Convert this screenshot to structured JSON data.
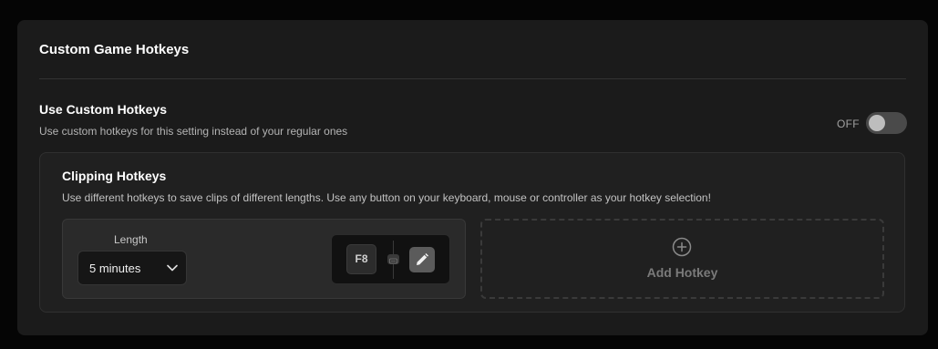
{
  "panel": {
    "title": "Custom Game Hotkeys"
  },
  "custom_hotkeys": {
    "title": "Use Custom Hotkeys",
    "description": "Use custom hotkeys for this setting instead of your regular ones",
    "toggle_label": "OFF",
    "toggle_on": false
  },
  "clipping": {
    "title": "Clipping Hotkeys",
    "description": "Use different hotkeys to save clips of different lengths. Use any button on your keyboard, mouse or controller as your hotkey selection!",
    "hotkeys": [
      {
        "length_label": "Length",
        "length_value": "5 minutes",
        "key": "F8",
        "device_icon": "keyboard-icon",
        "edit_icon": "pencil-icon"
      }
    ],
    "add_label": "Add Hotkey",
    "add_icon": "plus-circle-icon"
  },
  "colors": {
    "background": "#050505",
    "panel": "#1b1b1b",
    "subpanel": "#202020",
    "card": "#2a2a2a",
    "toggle_off": "#4a4a4a"
  }
}
